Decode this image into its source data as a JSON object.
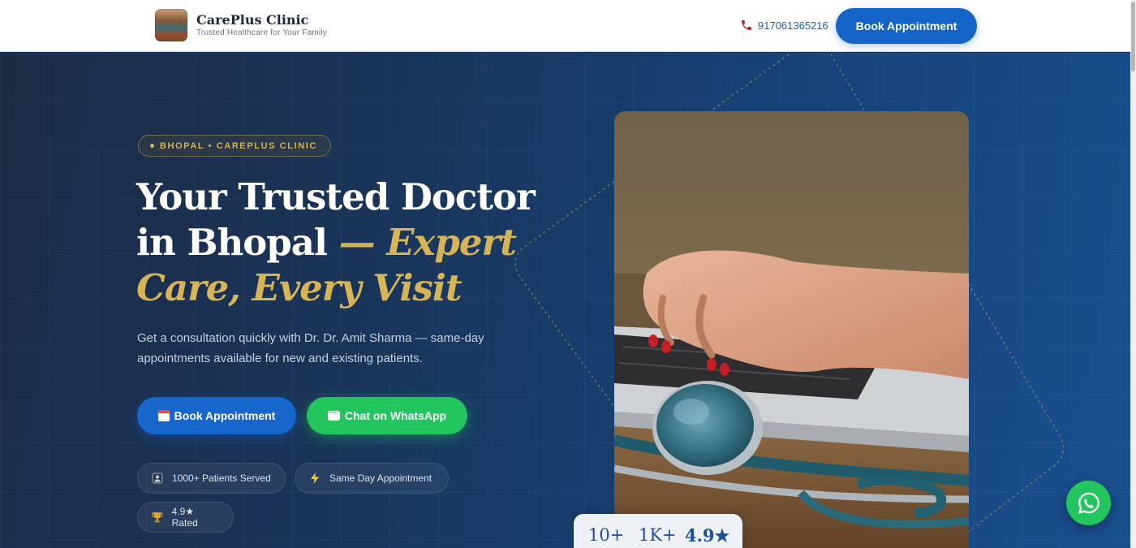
{
  "header": {
    "brand_name": "CarePlus Clinic",
    "brand_tagline": "Trusted Healthcare for Your Family",
    "phone": "917061365216",
    "cta_label": "Book Appointment"
  },
  "hero": {
    "badge": "BHOPAL • CAREPLUS CLINIC",
    "headline_white": "Your Trusted Doctor in Bhopal ",
    "headline_gold": "— Expert Care, Every Visit",
    "subtext": "Get a consultation quickly with Dr. Dr. Amit Sharma — same-day appointments available for new and existing patients.",
    "primary_button": "Book Appointment",
    "whatsapp_button": "Chat on WhatsApp",
    "chips": [
      {
        "label": "1000+ Patients Served",
        "icon": "patients-icon"
      },
      {
        "label": "Same Day Appointment",
        "icon": "lightning-icon"
      },
      {
        "label": "4.9★ Rated",
        "icon": "trophy-icon"
      }
    ],
    "stats": [
      "10+",
      "1K+",
      "4.9★"
    ]
  },
  "colors": {
    "primary": "#1464c8",
    "gold": "#d6b458",
    "whatsapp": "#22c55e",
    "hero_dark": "#1c2b44",
    "hero_blue": "#1a4f8f"
  }
}
